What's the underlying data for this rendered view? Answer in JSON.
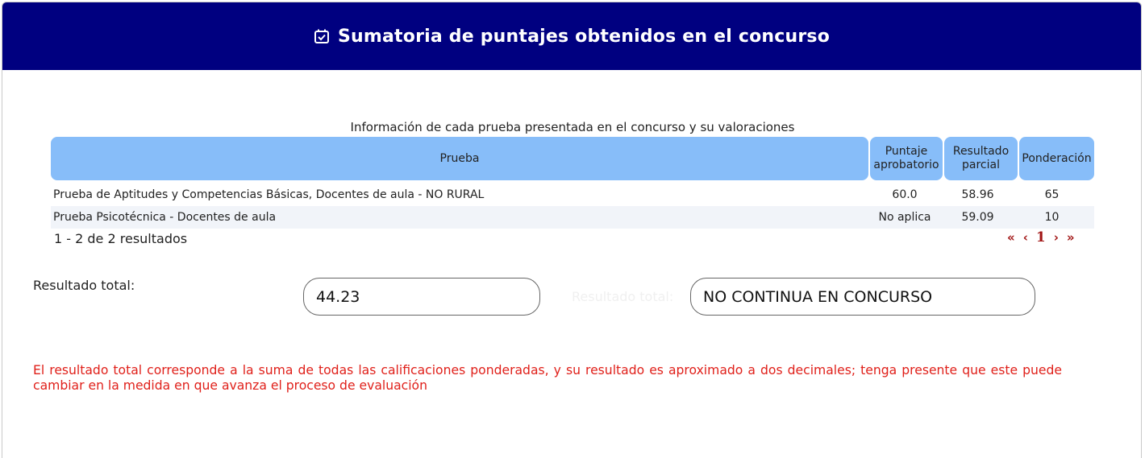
{
  "header": {
    "title": "Sumatoria de puntajes obtenidos en el concurso",
    "icon": "calendar-check-icon"
  },
  "table": {
    "caption": "Información de cada prueba presentada en el concurso y su valoraciones",
    "columns": [
      "Prueba",
      "Puntaje aprobatorio",
      "Resultado parcial",
      "Ponderación"
    ],
    "rows": [
      [
        "Prueba de Aptitudes y Competencias Básicas, Docentes de aula - NO RURAL",
        "60.0",
        "58.96",
        "65"
      ],
      [
        "Prueba Psicotécnica - Docentes de aula",
        "No aplica",
        "59.09",
        "10"
      ]
    ]
  },
  "pagination": {
    "summary": "1 - 2 de 2 resultados",
    "first": "«",
    "prev": "‹",
    "current": "1",
    "next": "›",
    "last": "»"
  },
  "result": {
    "label": "Resultado total:",
    "value": "44.23",
    "status_label": "Resultado total:",
    "status_value": "NO CONTINUA EN CONCURSO"
  },
  "note": "El resultado total corresponde a la suma de todas las calificaciones ponderadas, y su resultado es aproximado a dos decimales; tenga presente que este puede cambiar en la medida en que avanza el proceso de evaluación",
  "colors": {
    "header_bg": "#000080",
    "table_header_bg": "#87bdf9",
    "alt_row_bg": "#f1f4f9",
    "note_text": "#e0201a",
    "pager": "#a11515"
  }
}
